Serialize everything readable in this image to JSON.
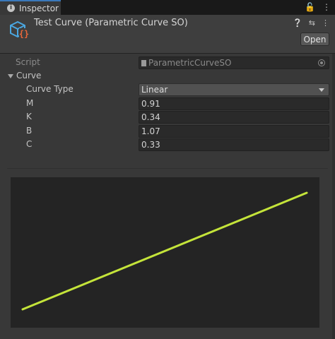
{
  "window": {
    "tab_label": "Inspector"
  },
  "header": {
    "title": "Test Curve (Parametric Curve SO)",
    "open_label": "Open"
  },
  "fields": {
    "script": {
      "label": "Script",
      "value": "ParametricCurveSO"
    },
    "curve": {
      "label": "Curve"
    },
    "curve_type": {
      "label": "Curve Type",
      "value": "Linear"
    },
    "m": {
      "label": "M",
      "value": "0.91"
    },
    "k": {
      "label": "K",
      "value": "0.34"
    },
    "b": {
      "label": "B",
      "value": "1.07"
    },
    "c": {
      "label": "C",
      "value": "0.33"
    }
  },
  "preview": {
    "line_color": "#c4e43a",
    "x": [
      0,
      1
    ],
    "y": [
      0,
      1
    ]
  },
  "colors": {
    "accent": "#3a79bb",
    "icon_blue": "#4aa6e0",
    "icon_orange": "#e8673a"
  }
}
